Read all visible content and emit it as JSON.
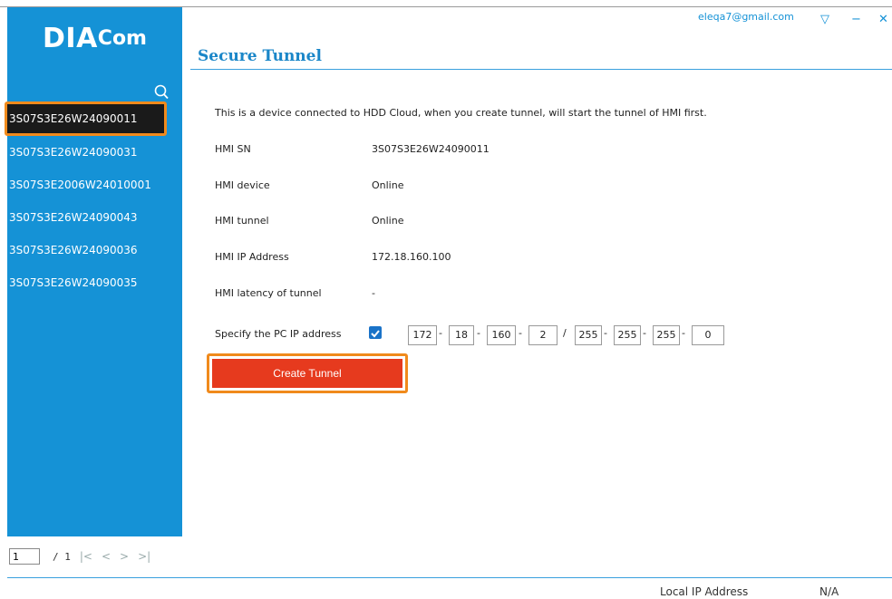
{
  "app": {
    "logo_big": "DIA",
    "logo_small": "Com"
  },
  "header": {
    "email": "eleqa7@gmail.com",
    "page_title": "Secure Tunnel"
  },
  "sidebar": {
    "search_placeholder": "",
    "devices": [
      "3S07S3E26W24090011",
      "3S07S3E26W24090031",
      "3S07S3E2006W24010001",
      "3S07S3E26W24090043",
      "3S07S3E26W24090036",
      "3S07S3E26W24090035"
    ],
    "selected_index": 0
  },
  "pager": {
    "current": "1",
    "total": "/ 1"
  },
  "main": {
    "info": "This is a device connected to HDD Cloud, when you create tunnel, will start the tunnel of HMI first.",
    "fields": [
      {
        "label": "HMI SN",
        "value": "3S07S3E26W24090011"
      },
      {
        "label": "HMI device",
        "value": "Online"
      },
      {
        "label": "HMI tunnel",
        "value": "Online"
      },
      {
        "label": "HMI IP Address",
        "value": "172.18.160.100"
      },
      {
        "label": "HMI latency of tunnel",
        "value": "-"
      }
    ],
    "pc_ip_label": "Specify the PC IP address",
    "pc_ip_checked": true,
    "ip": [
      "172",
      "18",
      "160",
      "2"
    ],
    "mask": [
      "255",
      "255",
      "255",
      "0"
    ],
    "ip_sep": "-",
    "mask_sep": "/",
    "create_button": "Create Tunnel"
  },
  "footer": {
    "local_ip_label": "Local IP Address",
    "local_ip_value": "N/A"
  },
  "colors": {
    "accent": "#1592d6",
    "highlight": "#f08a1c",
    "button": "#e63a1e"
  }
}
